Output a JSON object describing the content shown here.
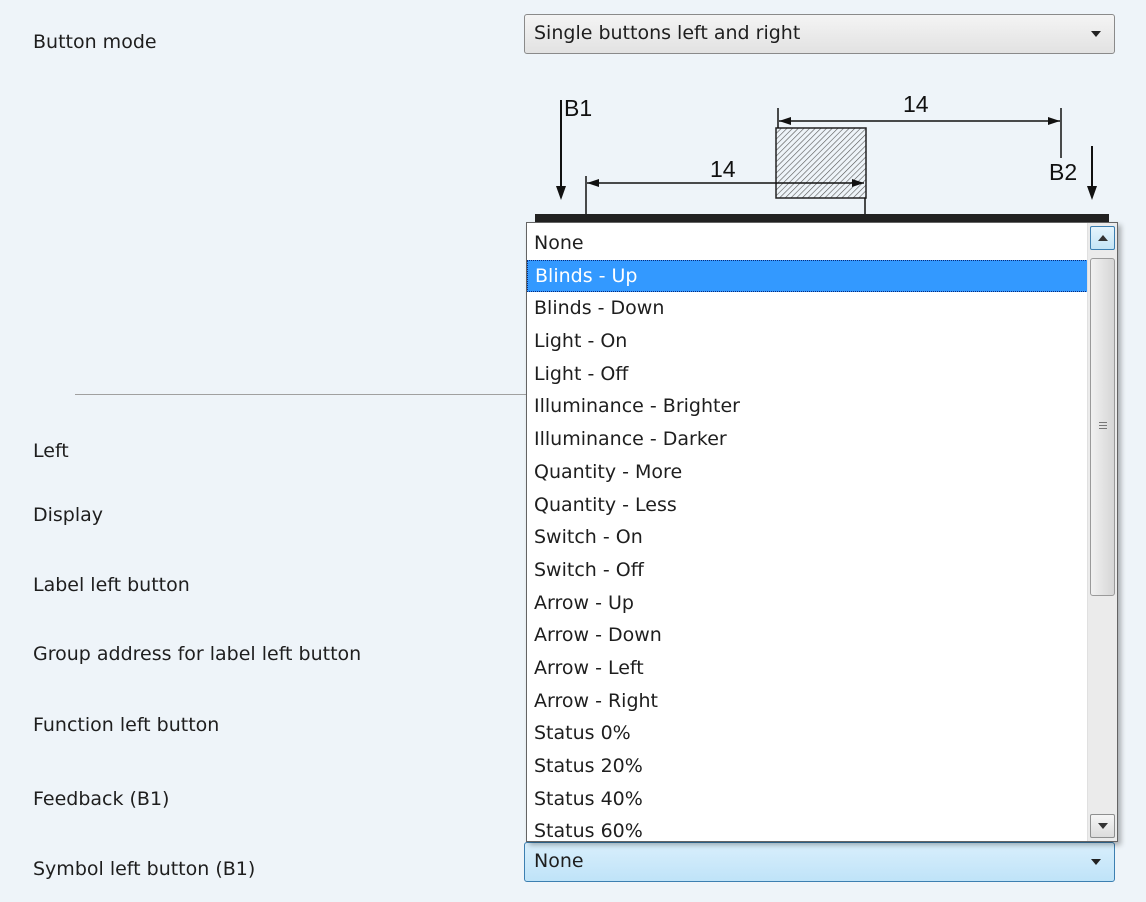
{
  "button_mode": {
    "label": "Button mode",
    "value": "Single buttons left and right"
  },
  "diagram": {
    "b1_label": "B1",
    "b2_label": "B2",
    "dim_top": "14",
    "dim_bottom": "14"
  },
  "fields": [
    {
      "label": "Left"
    },
    {
      "label": "Display"
    },
    {
      "label": "Label left button"
    },
    {
      "label": "Group address for label left button"
    },
    {
      "label": "Function left button"
    },
    {
      "label": "Feedback (B1)"
    },
    {
      "label": "Symbol left button (B1)"
    }
  ],
  "symbol_select": {
    "value": "None"
  },
  "dropdown": {
    "selected_index": 1,
    "options": [
      "None",
      "Blinds - Up",
      "Blinds - Down",
      "Light - On",
      "Light - Off",
      "Illuminance - Brighter",
      "Illuminance - Darker",
      "Quantity - More",
      "Quantity - Less",
      "Switch - On",
      "Switch - Off",
      "Arrow - Up",
      "Arrow - Down",
      "Arrow - Left",
      "Arrow - Right",
      "Status 0%",
      "Status 20%",
      "Status 40%",
      "Status 60%"
    ]
  },
  "colors": {
    "background": "#eef4f9",
    "selection": "#3399ff",
    "active_combo": "#bfe3f8"
  }
}
